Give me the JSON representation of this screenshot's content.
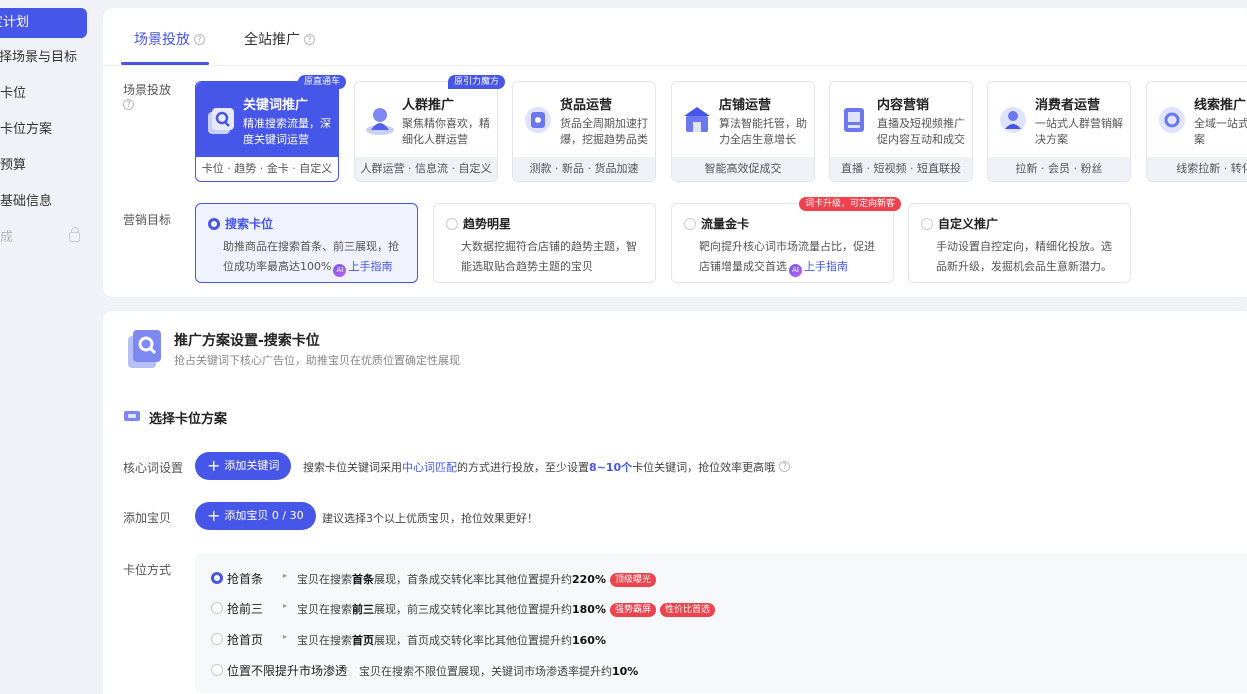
{
  "sidebar": {
    "items": [
      {
        "label": "定计划",
        "state": "active"
      },
      {
        "label": "选择场景与目标",
        "state": "normal"
      },
      {
        "label": "设置卡位",
        "state": "normal"
      },
      {
        "label": "设置卡位方案",
        "state": "normal"
      },
      {
        "label": "设置预算",
        "state": "normal"
      },
      {
        "label": "设置基础信息",
        "state": "normal"
      },
      {
        "label": "完成",
        "state": "locked"
      }
    ]
  },
  "tabs": [
    {
      "label": "场景投放",
      "active": true
    },
    {
      "label": "全站推广",
      "active": false
    }
  ],
  "scene_row_label": "场景投放",
  "scenes": [
    {
      "title": "关键词推广",
      "desc": "精准搜索流量，深度关键词运营",
      "tags": "卡位 · 趋势 · 金卡 · 自定义",
      "badge": "原直通车",
      "selected": true
    },
    {
      "title": "人群推广",
      "desc": "聚焦精你喜欢，精细化人群运营",
      "tags": "人群运营 · 信息流 · 自定义",
      "badge": "原引力魔方",
      "selected": false
    },
    {
      "title": "货品运营",
      "desc": "货品全周期加速打爆，挖掘趋势品类",
      "tags": "测款 · 新品 · 货品加速",
      "badge": "",
      "selected": false
    },
    {
      "title": "店铺运营",
      "desc": "算法智能托管，助力全店生意增长",
      "tags": "智能高效促成交",
      "badge": "",
      "selected": false
    },
    {
      "title": "内容营销",
      "desc": "直播及短视频推广促内容互动和成交",
      "tags": "直播 · 短视频 · 短直联投",
      "badge": "",
      "selected": false
    },
    {
      "title": "消费者运营",
      "desc": "一站式人群营销解决方案",
      "tags": "拉新 · 会员 · 粉丝",
      "badge": "",
      "selected": false
    },
    {
      "title": "线索推广",
      "desc": "全域一站式解决方案",
      "tags": "线索拉新 · 转化 ·",
      "badge": "",
      "selected": false
    }
  ],
  "goal_row_label": "营销目标",
  "goals": [
    {
      "title": "搜索卡位",
      "desc": "助推商品在搜索首条、前三展现，抢位成功率最高达100%",
      "link": "上手指南",
      "tag": "",
      "selected": true
    },
    {
      "title": "趋势明星",
      "desc": "大数据挖掘符合店铺的趋势主题，智能选取贴合趋势主题的宝贝",
      "link": "",
      "tag": "",
      "selected": false
    },
    {
      "title": "流量金卡",
      "desc": "靶向提升核心词市场流量占比，促进店铺增量成交首选",
      "link": "上手指南",
      "tag": "词卡升级，可定向新客",
      "selected": false
    },
    {
      "title": "自定义推广",
      "desc": "手动设置自控定向，精细化投放。选品新升级，发掘机会品生意新潜力。",
      "link": "",
      "tag": "",
      "selected": false
    }
  ],
  "ai_label": "AI",
  "plan": {
    "title": "推广方案设置-搜索卡位",
    "subtitle": "抢占关键词下核心广告位，助推宝贝在优质位置确定性展现",
    "section_title": "选择卡位方案",
    "keyword_label": "核心词设置",
    "keyword_button": "添加关键词",
    "keyword_note_pre": "搜索卡位关键词采用",
    "keyword_note_mid1": "中心词匹配",
    "keyword_note_mid2": "的方式进行投放，至少设置",
    "keyword_note_count": "8~10个",
    "keyword_note_post": "卡位关键词，抢位效率更高哦",
    "item_label": "添加宝贝",
    "item_button": "添加宝贝 0 / 30",
    "item_note": "建议选择3个以上优质宝贝，抢位效果更好！",
    "mode_label": "卡位方式"
  },
  "modes": [
    {
      "name": "抢首条",
      "desc_pre": "宝贝在搜索",
      "desc_bold": "首条",
      "desc_mid": "展现，首条成交转化率比其他位置提升约",
      "value": "220%",
      "chips": [
        "顶级曝光"
      ],
      "selected": true
    },
    {
      "name": "抢前三",
      "desc_pre": "宝贝在搜索",
      "desc_bold": "前三",
      "desc_mid": "展现，前三成交转化率比其他位置提升约",
      "value": "180%",
      "chips": [
        "强势霸屏",
        "性价比首选"
      ],
      "selected": false
    },
    {
      "name": "抢首页",
      "desc_pre": "宝贝在搜索",
      "desc_bold": "首页",
      "desc_mid": "展现，首页成交转化率比其他位置提升约",
      "value": "160%",
      "chips": [],
      "selected": false
    },
    {
      "name": "位置不限提升市场渗透",
      "desc_pre": "宝贝在搜索不限位置展现，关键词市场渗透率提升约",
      "desc_bold": "",
      "desc_mid": "",
      "value": "10%",
      "chips": [],
      "selected": false
    }
  ],
  "colors": {
    "accent": "#4656e8",
    "red": "#f0424c",
    "bg": "#f0f2f7"
  }
}
